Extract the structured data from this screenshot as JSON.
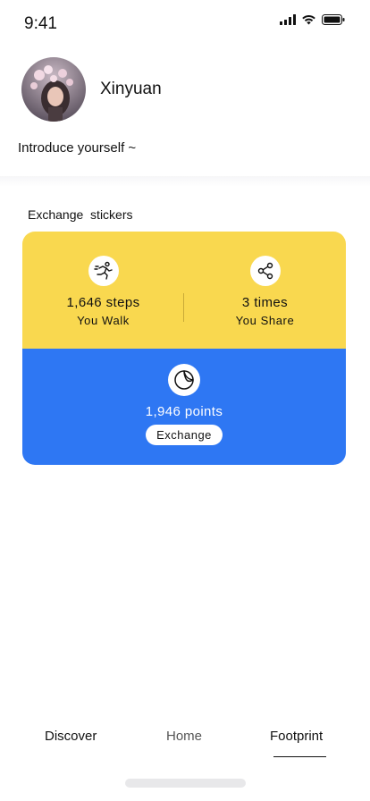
{
  "status_bar": {
    "time": "9:41",
    "icons": [
      "signal-icon",
      "wifi-icon",
      "battery-icon"
    ]
  },
  "profile": {
    "username": "Xinyuan",
    "intro": "Introduce yourself ~"
  },
  "section": {
    "title": "Exchange  stickers"
  },
  "card": {
    "walk": {
      "icon": "running-icon",
      "value": "1,646 steps",
      "label": "You Walk"
    },
    "share": {
      "icon": "share-icon",
      "value": "3 times",
      "label": "You Share"
    },
    "points": {
      "icon": "sticker-icon",
      "value": "1,946 points",
      "button": "Exchange"
    },
    "colors": {
      "top": "#f9d84f",
      "bottom": "#2e77f3"
    }
  },
  "tabbar": {
    "discover": "Discover",
    "home": "Home",
    "footprint": "Footprint",
    "active": "footprint"
  }
}
